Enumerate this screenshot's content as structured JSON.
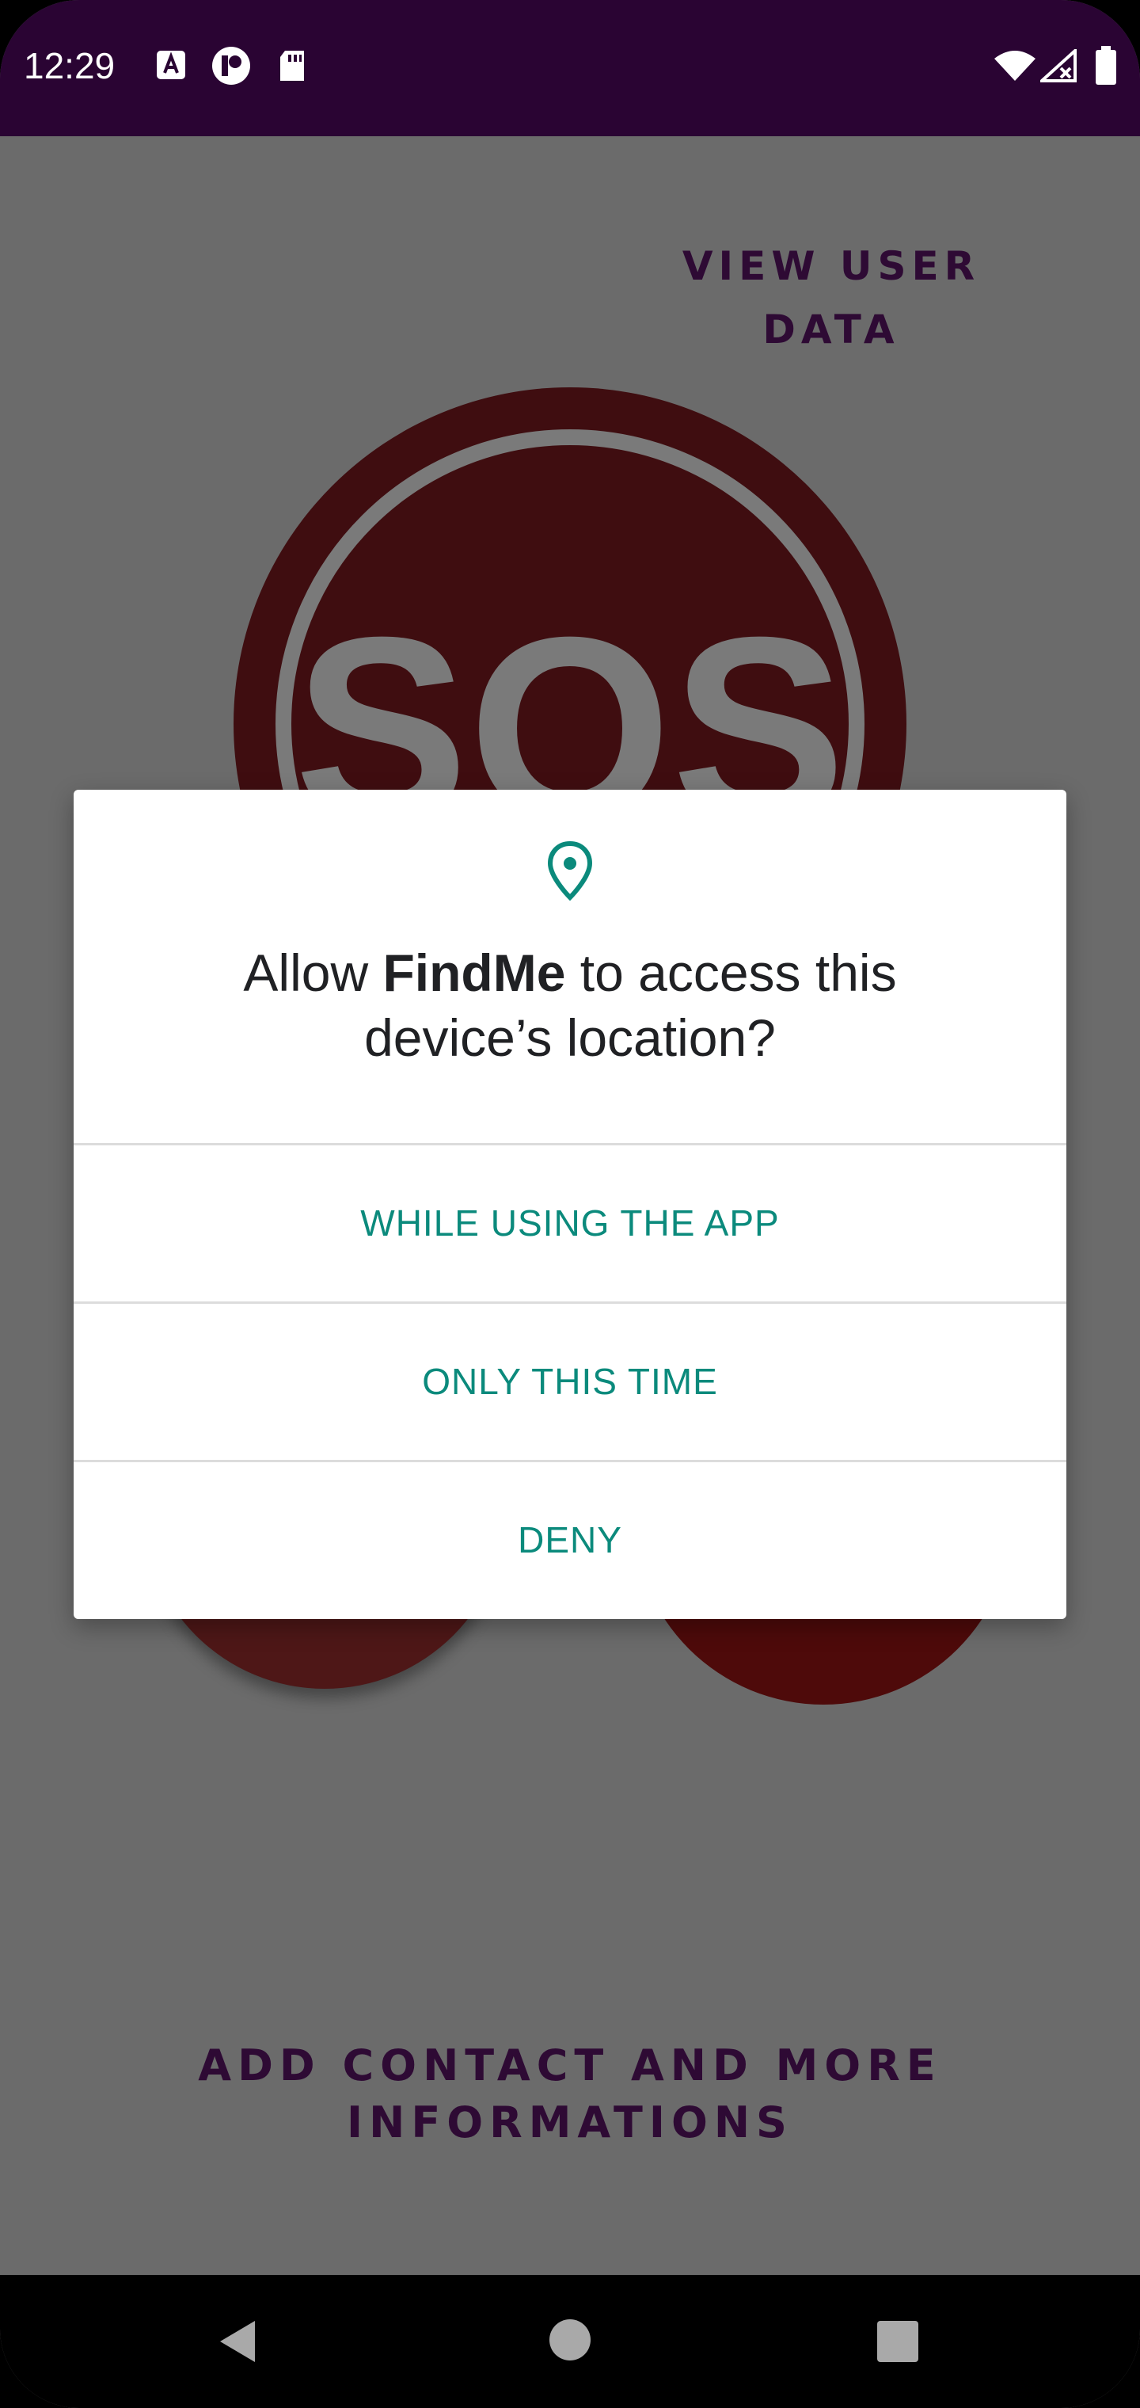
{
  "status_bar": {
    "time": "12:29",
    "icons": [
      "text-a-icon",
      "app-notification-icon",
      "sd-card-icon",
      "wifi-icon",
      "signal-icon",
      "battery-icon"
    ]
  },
  "main": {
    "view_user_data_label": "VIEW USER DATA",
    "sos_label": "SOS",
    "add_contact_label_line1": "ADD CONTACT AND MORE",
    "add_contact_label_line2": "INFORMATIONS"
  },
  "permission_dialog": {
    "icon": "location-pin-icon",
    "title_prefix": "Allow ",
    "app_name": "FindMe",
    "title_suffix_line1": " to access this",
    "title_line2": "device’s location?",
    "options": [
      {
        "label": "WHILE USING THE APP"
      },
      {
        "label": "ONLY THIS TIME"
      },
      {
        "label": "DENY"
      }
    ]
  },
  "colors": {
    "status_bar": "#2a0433",
    "scrim_background": "#6b6b6b",
    "accent_teal": "#0b8a7c",
    "app_text_purple": "#2e0a34",
    "sos_red": "#3f0d10"
  },
  "nav_bar": {
    "icons": [
      "back-icon",
      "home-icon",
      "recents-icon"
    ]
  }
}
